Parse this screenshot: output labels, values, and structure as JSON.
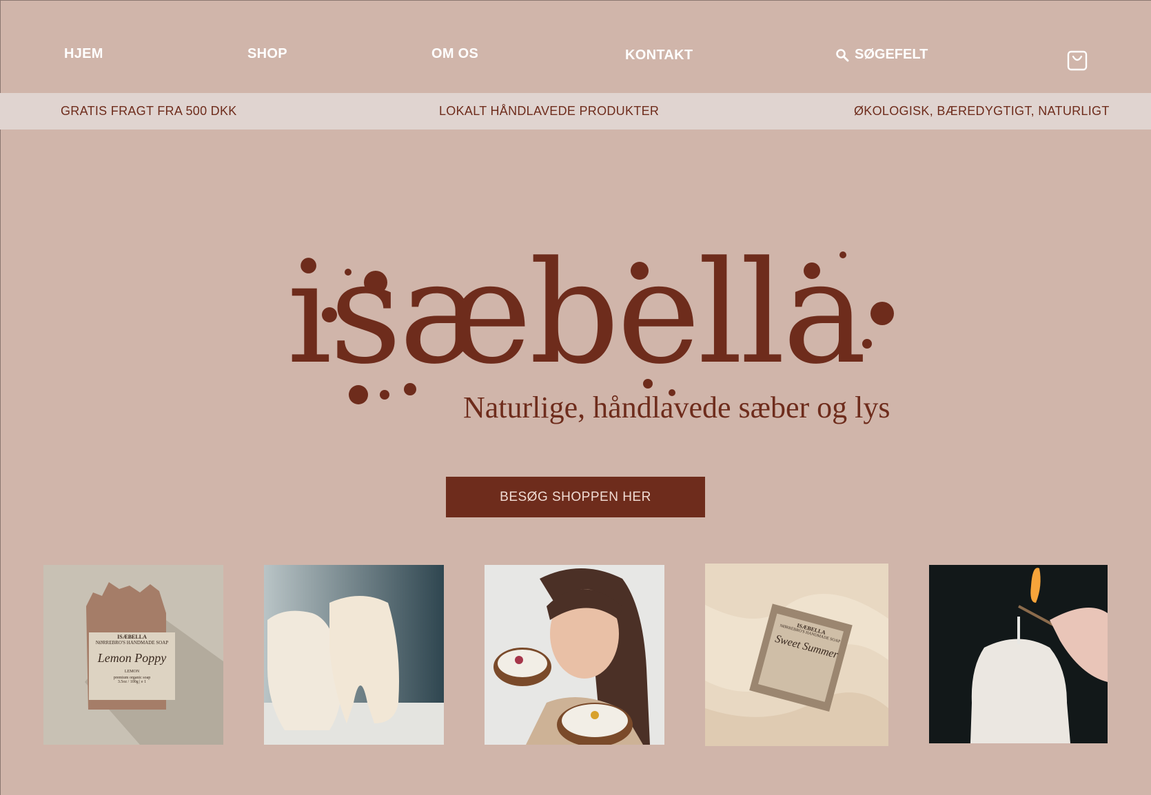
{
  "nav": {
    "items": [
      {
        "label": "HJEM"
      },
      {
        "label": "SHOP"
      },
      {
        "label": "OM OS"
      },
      {
        "label": "KONTAKT"
      }
    ],
    "search_label": "SØGEFELT",
    "search_icon": "search-icon",
    "cart_icon": "shopping-bag-icon"
  },
  "infobar": {
    "items": [
      "GRATIS FRAGT FRA 500 DKK",
      "LOKALT HÅNDLAVEDE PRODUKTER",
      "ØKOLOGISK, BÆREDYGTIGT, NATURLIGT"
    ]
  },
  "hero": {
    "logo_text": "isæbella",
    "tagline": "Naturlige, håndlavede sæber og lys",
    "cta_label": "BESØG SHOPPEN HER"
  },
  "gallery": {
    "soap_label": {
      "brand": "ISÆBELLA",
      "subtitle": "NØRREBRO'S HANDMADE SOAP",
      "name": "Lemon Poppy",
      "variant": "LEMON",
      "desc": "premium organic soap",
      "weight": "3.5oz / 100g | e 1"
    },
    "soap2_label": {
      "brand": "ISÆBELLA",
      "subtitle": "NØRREBRO'S HANDMADE SOAP",
      "name": "Sweet Summer"
    }
  },
  "colors": {
    "background": "#d0b5aa",
    "accent": "#6e2c1c",
    "infobar": "#e0d4d0",
    "nav_text": "#ffffff"
  }
}
